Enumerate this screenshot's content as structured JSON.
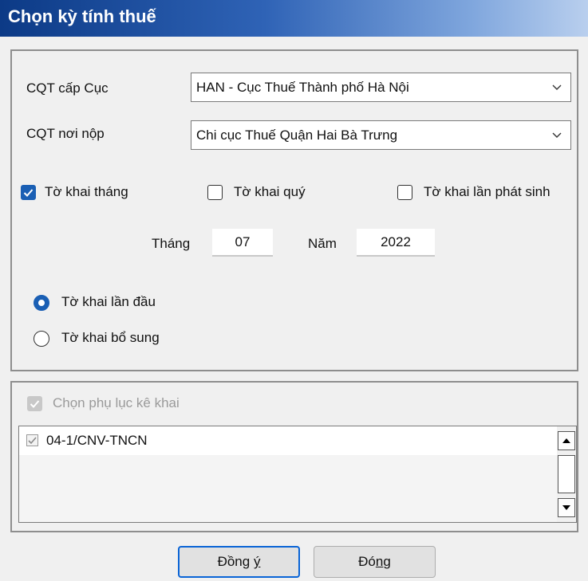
{
  "window": {
    "title": "Chọn kỳ tính thuế"
  },
  "cqt_cap_cuc": {
    "label": "CQT cấp Cục",
    "value": "HAN - Cục Thuế Thành phố Hà Nội"
  },
  "cqt_noi_nop": {
    "label": "CQT nơi nộp",
    "value": "Chi cục Thuế Quận Hai Bà Trưng"
  },
  "period_type": {
    "monthly": {
      "label": "Tờ khai tháng",
      "checked": true
    },
    "quarterly": {
      "label": "Tờ khai quý",
      "checked": false
    },
    "incidental": {
      "label": "Tờ khai lần phát sinh",
      "checked": false
    }
  },
  "month": {
    "label": "Tháng",
    "value": "07"
  },
  "year": {
    "label": "Năm",
    "value": "2022"
  },
  "declaration": {
    "first": {
      "label": "Tờ khai lần đầu",
      "selected": true
    },
    "supplement": {
      "label": "Tờ khai bổ sung",
      "selected": false
    }
  },
  "appendix": {
    "label": "Chọn phụ lục kê khai",
    "items": [
      {
        "label": "04-1/CNV-TNCN",
        "checked": true
      }
    ]
  },
  "buttons": {
    "ok": {
      "pre": "Đồng ",
      "mnemonic": "ý",
      "post": ""
    },
    "close": {
      "pre": "Đó",
      "mnemonic": "n",
      "post": "g"
    }
  },
  "colors": {
    "accent": "#1a5fb4",
    "title_start": "#0c3a86",
    "title_end": "#b9cfee"
  }
}
